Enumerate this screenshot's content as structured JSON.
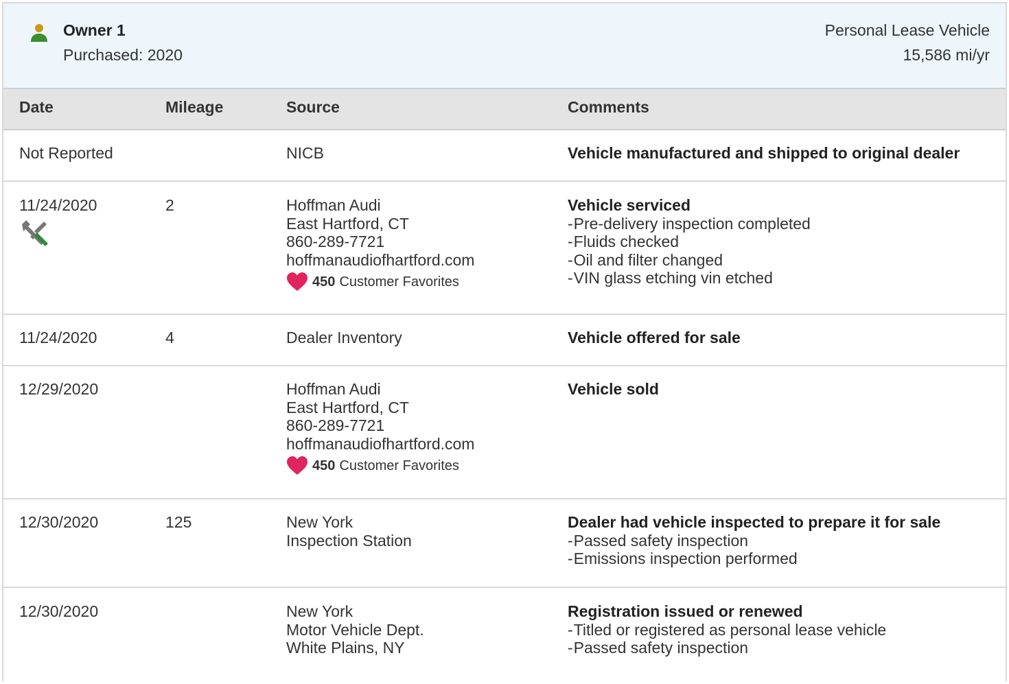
{
  "owner": {
    "name": "Owner 1",
    "purchased": "Purchased: 2020",
    "vehicle_type": "Personal Lease Vehicle",
    "miles_per_year": "15,586 mi/yr",
    "icon": "person-icon",
    "icon_color": "#3c8d2f"
  },
  "table": {
    "headers": {
      "date": "Date",
      "mileage": "Mileage",
      "source": "Source",
      "comments": "Comments"
    },
    "rows": [
      {
        "date": "Not Reported",
        "mileage": "",
        "source": [
          "NICB"
        ],
        "comment_title": "Vehicle manufactured and shipped to original dealer",
        "comment_items": []
      },
      {
        "date": "11/24/2020",
        "icon": "service-wrench-icon",
        "mileage": "2",
        "source": [
          "Hoffman Audi",
          "East Hartford, CT",
          "860-289-7721",
          "hoffmanaudiofhartford.com"
        ],
        "favorites": {
          "count": "450",
          "label": "Customer Favorites"
        },
        "comment_title": "Vehicle serviced",
        "comment_items": [
          "Pre-delivery inspection completed",
          "Fluids checked",
          "Oil and filter changed",
          "VIN glass etching vin etched"
        ]
      },
      {
        "date": "11/24/2020",
        "mileage": "4",
        "source": [
          "Dealer Inventory"
        ],
        "comment_title": "Vehicle offered for sale",
        "comment_items": []
      },
      {
        "date": "12/29/2020",
        "mileage": "",
        "source": [
          "Hoffman Audi",
          "East Hartford, CT",
          "860-289-7721",
          "hoffmanaudiofhartford.com"
        ],
        "favorites": {
          "count": "450",
          "label": "Customer Favorites"
        },
        "comment_title": "Vehicle sold",
        "comment_items": []
      },
      {
        "date": "12/30/2020",
        "mileage": "125",
        "source": [
          "New York",
          "Inspection Station"
        ],
        "comment_title": "Dealer had vehicle inspected to prepare it for sale",
        "comment_items": [
          "Passed safety inspection",
          "Emissions inspection performed"
        ]
      },
      {
        "date": "12/30/2020",
        "mileage": "",
        "source": [
          "New York",
          "Motor Vehicle Dept.",
          "White Plains, NY"
        ],
        "comment_title": "Registration issued or renewed",
        "comment_items": [
          "Titled or registered as personal lease vehicle",
          "Passed safety inspection"
        ]
      }
    ]
  },
  "colors": {
    "header_bg": "#eef6fc",
    "table_head_bg": "#e4e4e4",
    "heart": "#e0245e",
    "wrench_gray": "#777777",
    "screwdriver_green": "#2e8b3a"
  }
}
